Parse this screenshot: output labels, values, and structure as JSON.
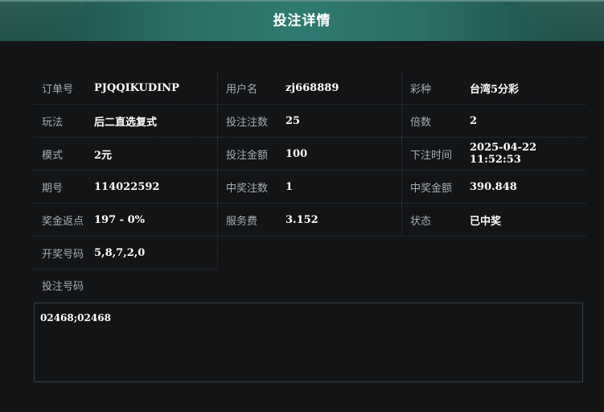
{
  "header": {
    "title": "投注详情"
  },
  "details": {
    "rows": [
      [
        {
          "label": "订单号",
          "value": "PJQQIKUDINP"
        },
        {
          "label": "用户名",
          "value": "zj668889"
        },
        {
          "label": "彩种",
          "value": "台湾5分彩"
        }
      ],
      [
        {
          "label": "玩法",
          "value": "后二直选复式"
        },
        {
          "label": "投注注数",
          "value": "25"
        },
        {
          "label": "倍数",
          "value": "2"
        }
      ],
      [
        {
          "label": "模式",
          "value": "2元"
        },
        {
          "label": "投注金额",
          "value": "100"
        },
        {
          "label": "下注时间",
          "value": "2025-04-22 11:52:53"
        }
      ],
      [
        {
          "label": "期号",
          "value": "114022592"
        },
        {
          "label": "中奖注数",
          "value": "1"
        },
        {
          "label": "中奖金额",
          "value": "390.848"
        }
      ],
      [
        {
          "label": "奖金返点",
          "value": "197 - 0%"
        },
        {
          "label": "服务费",
          "value": "3.152"
        },
        {
          "label": "状态",
          "value": "已中奖"
        }
      ]
    ],
    "last": {
      "label": "开奖号码",
      "value": "5,8,7,2,0"
    }
  },
  "bet": {
    "label": "投注号码",
    "numbers": "02468;02468"
  }
}
